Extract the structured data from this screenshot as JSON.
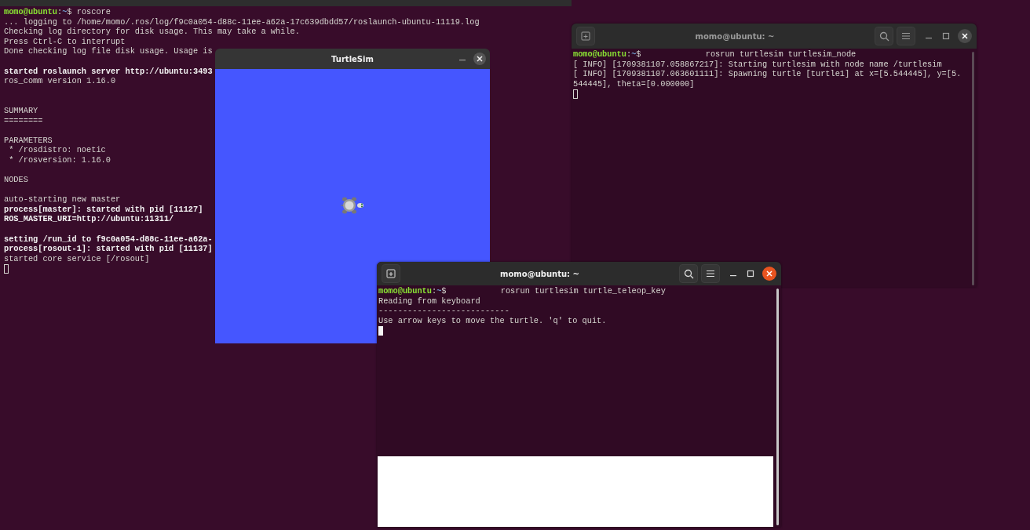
{
  "background_terminal": {
    "lines": [
      {
        "kind": "prompt",
        "user": "momo@ubuntu",
        "colon": ":",
        "path": "~",
        "symbol": "$",
        "command": "roscore"
      },
      {
        "kind": "text",
        "text": "... logging to /home/momo/.ros/log/f9c0a054-d88c-11ee-a62a-17c639dbdd57/roslaunch-ubuntu-11119.log"
      },
      {
        "kind": "text",
        "text": "Checking log directory for disk usage. This may take a while."
      },
      {
        "kind": "text",
        "text": "Press Ctrl-C to interrupt"
      },
      {
        "kind": "text",
        "text": "Done checking log file disk usage. Usage is"
      },
      {
        "kind": "blank"
      },
      {
        "kind": "bold",
        "text": "started roslaunch server http://ubuntu:3493"
      },
      {
        "kind": "text",
        "text": "ros_comm version 1.16.0"
      },
      {
        "kind": "blank"
      },
      {
        "kind": "blank"
      },
      {
        "kind": "text",
        "text": "SUMMARY"
      },
      {
        "kind": "text",
        "text": "========"
      },
      {
        "kind": "blank"
      },
      {
        "kind": "text",
        "text": "PARAMETERS"
      },
      {
        "kind": "text",
        "text": " * /rosdistro: noetic"
      },
      {
        "kind": "text",
        "text": " * /rosversion: 1.16.0"
      },
      {
        "kind": "blank"
      },
      {
        "kind": "text",
        "text": "NODES"
      },
      {
        "kind": "blank"
      },
      {
        "kind": "text",
        "text": "auto-starting new master"
      },
      {
        "kind": "bold",
        "text": "process[master]: started with pid [11127]"
      },
      {
        "kind": "bold",
        "text": "ROS_MASTER_URI=http://ubuntu:11311/"
      },
      {
        "kind": "blank"
      },
      {
        "kind": "bold",
        "text": "setting /run_id to f9c0a054-d88c-11ee-a62a-"
      },
      {
        "kind": "bold",
        "text": "process[rosout-1]: started with pid [11137]"
      },
      {
        "kind": "text",
        "text": "started core service [/rosout]"
      },
      {
        "kind": "cursor"
      }
    ]
  },
  "turtlesim": {
    "title": "TurtleSim"
  },
  "terminals": [
    {
      "title": "momo@ubuntu: ~",
      "focused": false,
      "lines": [
        {
          "kind": "prompt_spaced",
          "user": "momo@ubuntu",
          "colon": ":",
          "path": "~",
          "symbol": "$",
          "command": "rosrun turtlesim turtlesim_node"
        },
        {
          "kind": "text",
          "text": "[ INFO] [1709381107.058867217]: Starting turtlesim with node name /turtlesim"
        },
        {
          "kind": "text",
          "text": "[ INFO] [1709381107.063601111]: Spawning turtle [turtle1] at x=[5.544445], y=[5."
        },
        {
          "kind": "text",
          "text": "544445], theta=[0.000000]"
        },
        {
          "kind": "cursor"
        }
      ]
    },
    {
      "title": "momo@ubuntu: ~",
      "focused": true,
      "lines": [
        {
          "kind": "prompt_spaced",
          "user": "momo@ubuntu",
          "colon": ":",
          "path": "~",
          "symbol": "$",
          "command": "rosrun turtlesim turtle_teleop_key"
        },
        {
          "kind": "text",
          "text": "Reading from keyboard"
        },
        {
          "kind": "text",
          "text": "---------------------------"
        },
        {
          "kind": "text",
          "text": "Use arrow keys to move the turtle. 'q' to quit."
        },
        {
          "kind": "cursor"
        }
      ]
    }
  ]
}
